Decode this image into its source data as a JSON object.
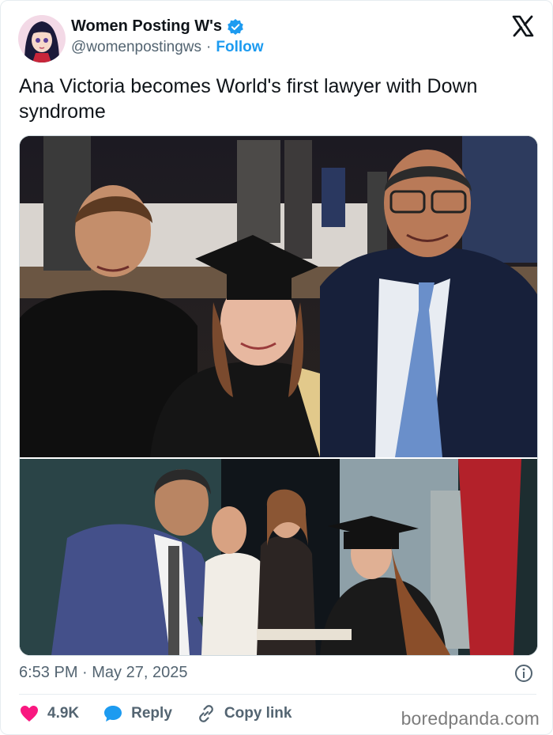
{
  "author": {
    "name": "Women Posting W's",
    "handle": "@womenpostingws",
    "separator": "·",
    "follow_label": "Follow"
  },
  "tweet": {
    "text": "Ana Victoria becomes World's first lawyer with Down syndrome"
  },
  "media": {
    "photo_top_desc": "",
    "photo_bottom_desc": ""
  },
  "meta": {
    "timestamp": "6:53 PM · May 27, 2025"
  },
  "actions": {
    "likes": "4.9K",
    "reply_label": "Reply",
    "copy_label": "Copy link"
  },
  "watermark": "boredpanda.com",
  "colors": {
    "accent": "#1d9bf0",
    "like": "#f91880",
    "text": "#0f1419",
    "muted": "#536471"
  },
  "icons": [
    "verified-badge-icon",
    "x-logo-icon",
    "info-icon",
    "heart-icon",
    "reply-bubble-icon",
    "link-icon"
  ]
}
